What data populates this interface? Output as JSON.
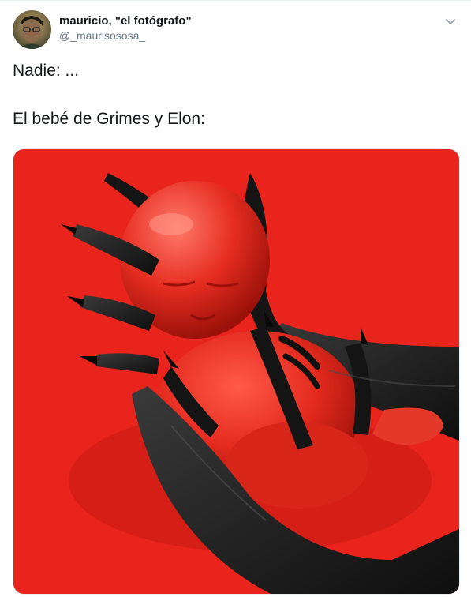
{
  "tweet": {
    "author": {
      "display_name": "mauricio, \"el fotógrafo\"",
      "handle": "@_maurisososa_"
    },
    "menu_icon": "chevron-down-icon",
    "lines": [
      "Nadie: ...",
      "El bebé de Grimes y Elon:"
    ],
    "media": {
      "background_color": "#e8241c",
      "hand_color": "#1b1b1b"
    }
  }
}
